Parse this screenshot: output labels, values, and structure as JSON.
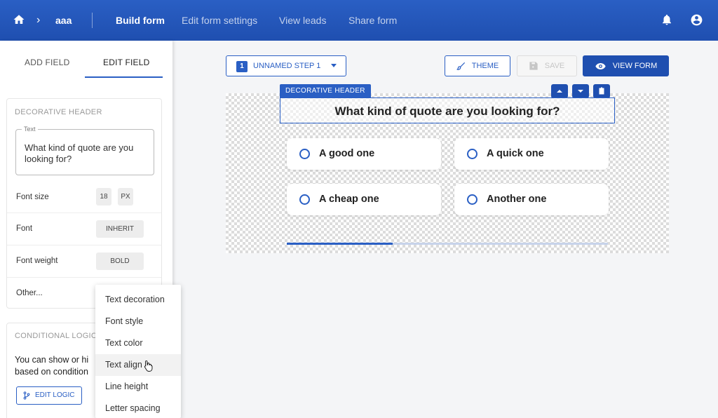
{
  "topbar": {
    "breadcrumb": "aaa",
    "nav": [
      "Build form",
      "Edit form settings",
      "View leads",
      "Share form"
    ],
    "active_nav": "Build form"
  },
  "sidebar": {
    "tabs": [
      "ADD FIELD",
      "EDIT FIELD"
    ],
    "active_tab": "EDIT FIELD",
    "field_card": {
      "title": "DECORATIVE HEADER",
      "text_label": "Text",
      "text_value": "What kind of quote are you looking for?",
      "font_size_label": "Font size",
      "font_size_value": "18",
      "font_size_unit": "PX",
      "font_label": "Font",
      "font_value": "INHERIT",
      "font_weight_label": "Font weight",
      "font_weight_value": "BOLD",
      "other_label": "Other..."
    },
    "logic_card": {
      "title": "CONDITIONAL LOGIC",
      "text_line1": "You can show or hi",
      "text_line2": "based on condition",
      "button": "EDIT LOGIC"
    }
  },
  "other_menu": {
    "items": [
      "Text decoration",
      "Font style",
      "Text color",
      "Text align",
      "Line height",
      "Letter spacing"
    ],
    "hovered": "Text align"
  },
  "toolbar": {
    "step_number": "1",
    "step_label": "UNNAMED STEP 1",
    "theme": "THEME",
    "save": "SAVE",
    "view_form": "VIEW FORM"
  },
  "form": {
    "selected_tag": "DECORATIVE HEADER",
    "header": "What kind of quote are you looking for?",
    "options": [
      "A good one",
      "A quick one",
      "A cheap one",
      "Another one"
    ],
    "progress": 0.33
  },
  "colors": {
    "primary": "#2a5fc4",
    "topbar": "#1f4fb0"
  }
}
